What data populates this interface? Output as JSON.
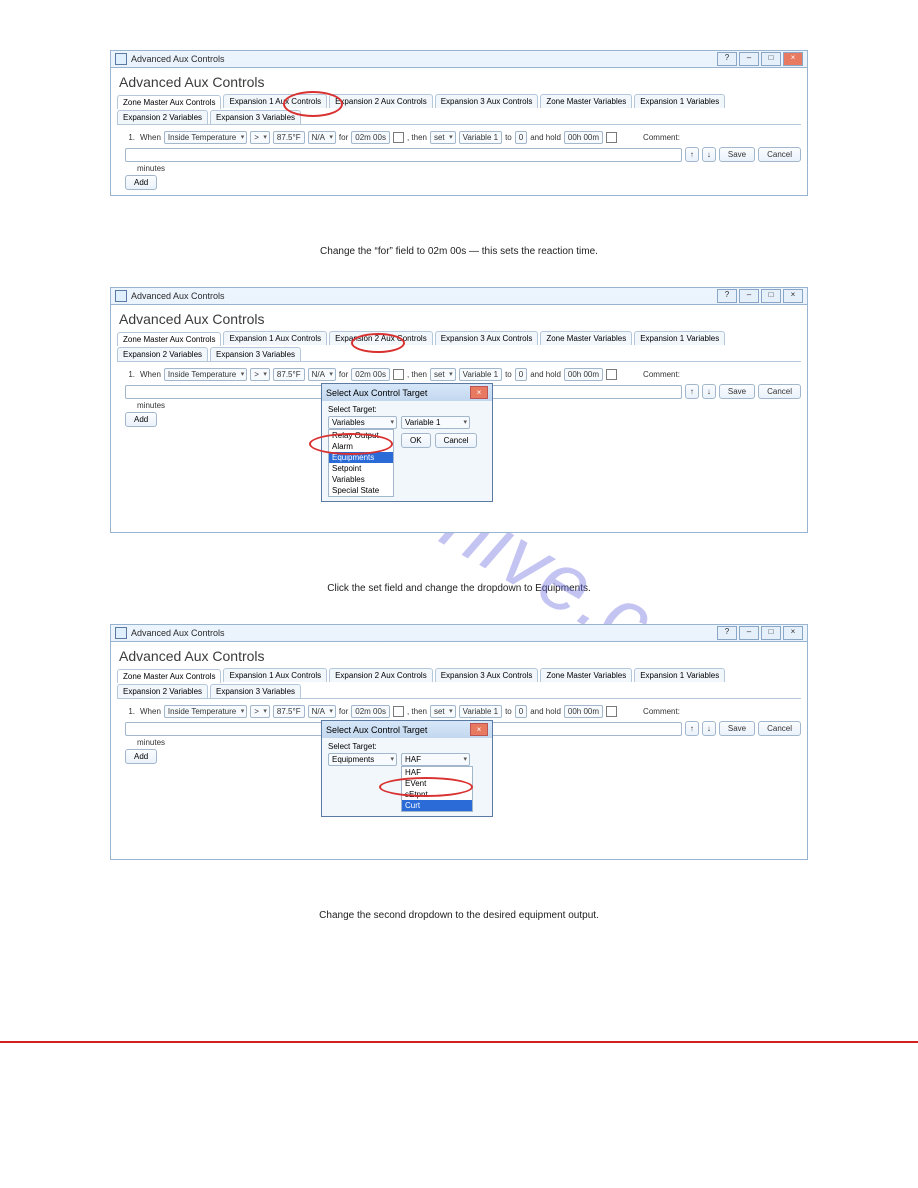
{
  "watermark": "manualshive.com",
  "window_title": "Advanced Aux Controls",
  "heading": "Advanced Aux Controls",
  "tabs": [
    "Zone Master Aux Controls",
    "Expansion 1 Aux Controls",
    "Expansion 2 Aux Controls",
    "Expansion 3 Aux Controls",
    "Zone Master Variables",
    "Expansion 1 Variables",
    "Expansion 2 Variables",
    "Expansion 3 Variables"
  ],
  "rule": {
    "num": "1.",
    "when": "When",
    "sensor": "Inside Temperature",
    "op": ">",
    "temp": "87.5°F",
    "na": "N/A",
    "for": "for",
    "reaction": "02m 00s",
    "hold_dur": "02m 00s",
    "then": ", then",
    "set": "set",
    "target": "Variable 1",
    "to": "to",
    "val": "0",
    "and_hold": "and hold",
    "hold_time": "00h 00m",
    "minutes": "minutes"
  },
  "comment_label": "Comment:",
  "buttons": {
    "add": "Add",
    "save": "Save",
    "cancel": "Cancel",
    "ok": "OK",
    "up": "↑",
    "down": "↓"
  },
  "dialog": {
    "title": "Select Aux Control Target",
    "select_target": "Select Target:",
    "current": "Variables",
    "current2": "Equipments",
    "value": "Variable 1",
    "value2": "HAF",
    "options1": [
      "Relay Output",
      "Alarm",
      "Equipments",
      "Setpoint",
      "Variables",
      "Special State"
    ],
    "options2": [
      "HAF",
      "EVent",
      "sEtpnt",
      "Curt"
    ]
  },
  "captions": {
    "c1": "Change the “for” field to 02m 00s — this sets the reaction time.",
    "c2": "Click the set field and change the dropdown to Equipments.",
    "c3": "Change the second dropdown to the desired equipment output."
  }
}
